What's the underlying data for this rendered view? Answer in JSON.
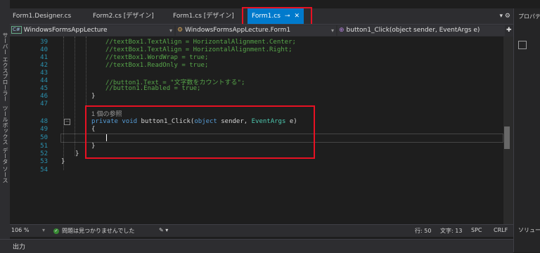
{
  "tabs": [
    {
      "label": "Form1.Designer.cs"
    },
    {
      "label": "Form2.cs [デザイン]"
    },
    {
      "label": "Form1.cs [デザイン]"
    },
    {
      "label": "Form1.cs",
      "active": true,
      "pin": "⊸",
      "close": "✕"
    }
  ],
  "tab_menu": {
    "dropdown": "▾",
    "settings": "⚙"
  },
  "left_sidebar": [
    "サーバー エクスプローラー",
    "ツールボックス",
    "データ ソース"
  ],
  "nav": {
    "project": "WindowsFormsAppLecture",
    "class": "WindowsFormsAppLecture.Form1",
    "member": "button1_Click(object sender, EventArgs e)",
    "project_icon": "C#"
  },
  "code_lines": [
    {
      "num": "39",
      "text": "//textBox1.TextAlign = HorizontalAlignment.Center;"
    },
    {
      "num": "40",
      "text": "//textBox1.TextAlign = HorizontalAlignment.Right;"
    },
    {
      "num": "41",
      "text": "//textBox1.WordWrap = true;"
    },
    {
      "num": "42",
      "text": "//textBox1.ReadOnly = true;"
    },
    {
      "num": "43",
      "text": ""
    },
    {
      "num": "44",
      "text": "//button1.Text = \"文字数をカウントする\";"
    },
    {
      "num": "45",
      "text": "//button1.Enabled = true;"
    },
    {
      "num": "46",
      "text": "}"
    },
    {
      "num": "47",
      "text": ""
    },
    {
      "num": "48",
      "text": "private void button1_Click(object sender, EventArgs e)"
    },
    {
      "num": "49",
      "text": "{"
    },
    {
      "num": "50",
      "text": ""
    },
    {
      "num": "51",
      "text": "}"
    },
    {
      "num": "52",
      "text": "}"
    },
    {
      "num": "53",
      "text": "}"
    },
    {
      "num": "54",
      "text": ""
    }
  ],
  "code_tokens": {
    "kw_private": "private",
    "kw_void": "void",
    "method": " button1_Click(",
    "kw_object": "object",
    "sender": " sender, ",
    "type_eventargs": "EventArgs",
    "e": " e)"
  },
  "ref_count": "1 個の参照",
  "status": {
    "zoom": "106 %",
    "issues": "問題は見つかりませんでした",
    "line": "行: 50",
    "col": "文字: 13",
    "spc": "SPC",
    "crlf": "CRLF"
  },
  "output_label": "出力",
  "right_panel": {
    "title": "プロパティ",
    "bottom": "ソリュー"
  },
  "colors": {
    "accent": "#007acc",
    "highlight_box": "#e81123",
    "comment": "#57a64a",
    "keyword": "#569cd6",
    "type": "#4ec9b0"
  }
}
